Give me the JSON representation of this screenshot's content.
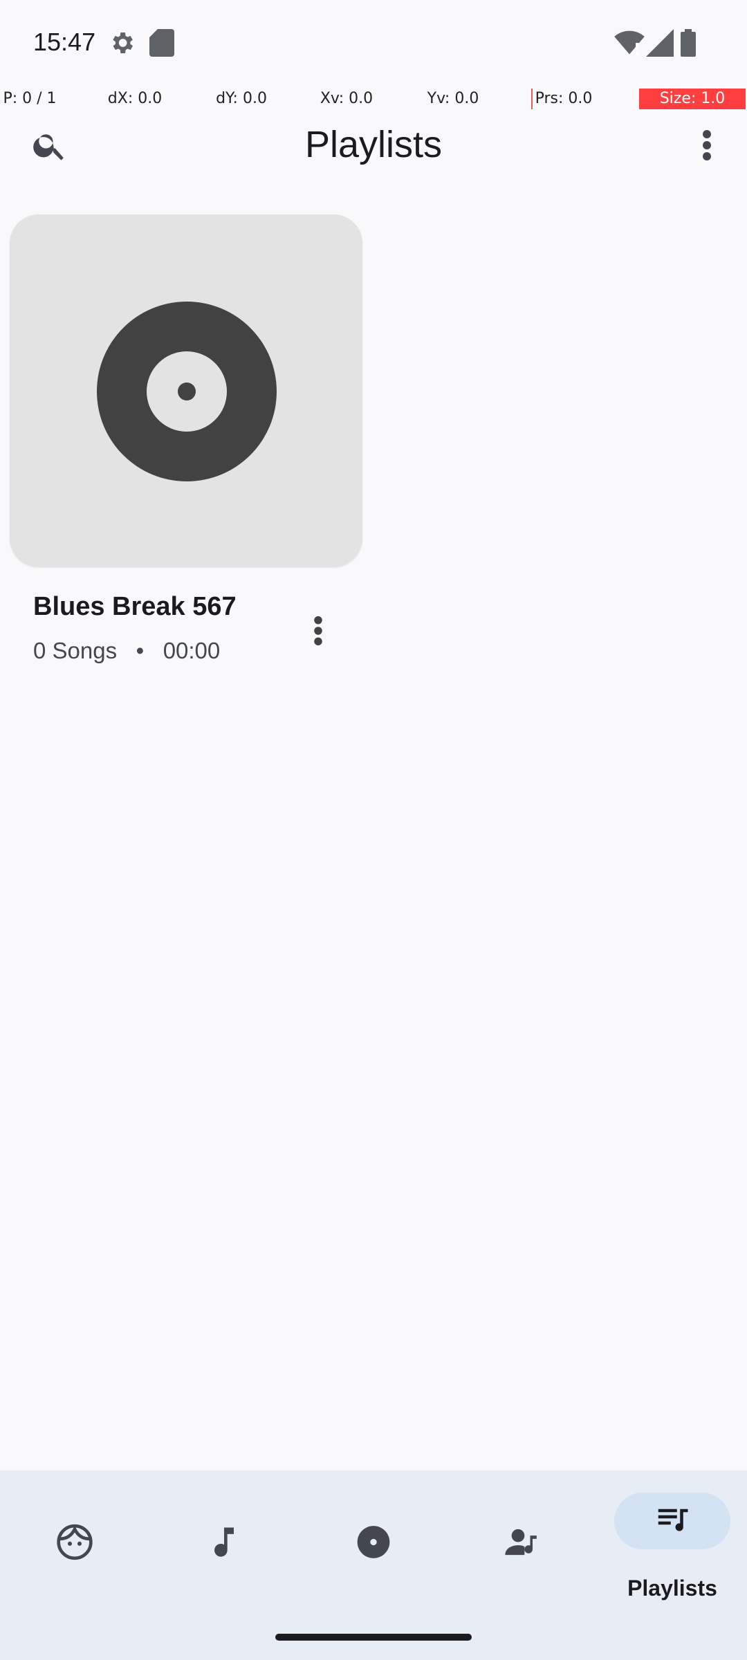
{
  "status_bar": {
    "time": "15:47",
    "icons": [
      "settings-gear-icon",
      "sd-card-icon",
      "wifi-alert-icon",
      "cell-signal-icon",
      "battery-icon"
    ]
  },
  "pointer_location": {
    "cells": [
      "P: 0 / 1",
      "dX: 0.0",
      "dY: 0.0",
      "Xv: 0.0",
      "Yv: 0.0",
      "Prs: 0.0",
      "Size: 1.0"
    ]
  },
  "app_bar": {
    "title": "Playlists",
    "search_icon": "search-icon",
    "more_icon": "more-vert-icon"
  },
  "playlists": [
    {
      "title": "Blues Break 567",
      "songs": "0 Songs",
      "separator": "•",
      "duration": "00:00"
    }
  ],
  "bottom_nav": {
    "items": [
      {
        "icon": "face-icon",
        "label": ""
      },
      {
        "icon": "music-note-icon",
        "label": ""
      },
      {
        "icon": "album-icon",
        "label": ""
      },
      {
        "icon": "artist-icon",
        "label": ""
      },
      {
        "icon": "playlist-icon",
        "label": "Playlists",
        "selected": true
      }
    ]
  },
  "colors": {
    "background": "#f9f9fc",
    "nav_background": "#e7edf5",
    "nav_pill": "#d3e3f4",
    "album_art_bg": "#e3e3e3",
    "icon_dark": "#424242",
    "pointer_red": "#ff3f3f"
  }
}
